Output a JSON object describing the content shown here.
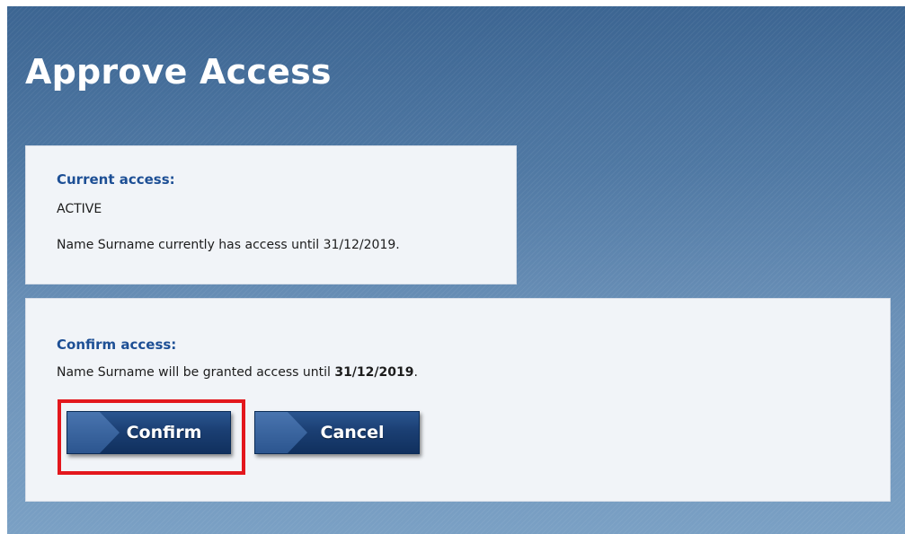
{
  "page": {
    "title": "Approve Access"
  },
  "current_access": {
    "heading": "Current access:",
    "status": "ACTIVE",
    "description": "Name Surname currently has access until 31/12/2019."
  },
  "confirm_access": {
    "heading": "Confirm access:",
    "description_prefix": "Name Surname will be granted access until ",
    "description_date": "31/12/2019",
    "description_suffix": "."
  },
  "buttons": {
    "confirm_label": "Confirm",
    "cancel_label": "Cancel"
  },
  "colors": {
    "highlight": "#e3171d",
    "heading_blue": "#1d4f95",
    "button_navy": "#1b3f73"
  }
}
